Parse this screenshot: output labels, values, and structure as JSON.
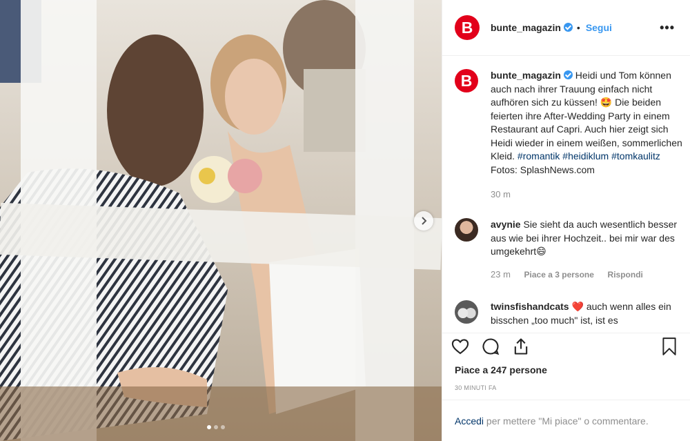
{
  "header": {
    "avatar_letter": "B",
    "username": "bunte_magazin",
    "bullet": "•",
    "follow_label": "Segui",
    "more_label": "•••"
  },
  "caption": {
    "username": "bunte_magazin",
    "text_before": "Heidi und Tom können auch nach ihrer Trauung einfach nicht aufhören sich zu küssen! 🤩 Die beiden feierten ihre After-Wedding Party in einem Restaurant auf Capri. Auch hier zeigt sich Heidi wieder in einem weißen, sommerlichen Kleid.",
    "hashtags": [
      "#romantik",
      "#heidiklum",
      "#tomkaulitz"
    ],
    "credit": "Fotos: SplashNews.com",
    "time": "30 m"
  },
  "comments": [
    {
      "username": "avynie",
      "text": "Sie sieht da auch wesentlich besser aus wie bei ihrer Hochzeit.. bei mir war des umgekehrt😄",
      "time": "23 m",
      "likes": "Piace a 3 persone",
      "reply": "Rispondi"
    },
    {
      "username": "twinsfishandcats",
      "text_prefix": "❤️",
      "text": "auch wenn alles ein bisschen „too much\" ist, ist es"
    }
  ],
  "likes_text": "Piace a 247 persone",
  "post_time": "30 MINUTI FA",
  "login": {
    "link": "Accedi",
    "rest": "per mettere \"Mi piace\" o commentare."
  },
  "carousel": {
    "slides": 3,
    "active": 0
  },
  "colors": {
    "brand": "#e2001a",
    "link": "#3897f0",
    "hashtag": "#003569",
    "muted": "#8e8e8e"
  }
}
